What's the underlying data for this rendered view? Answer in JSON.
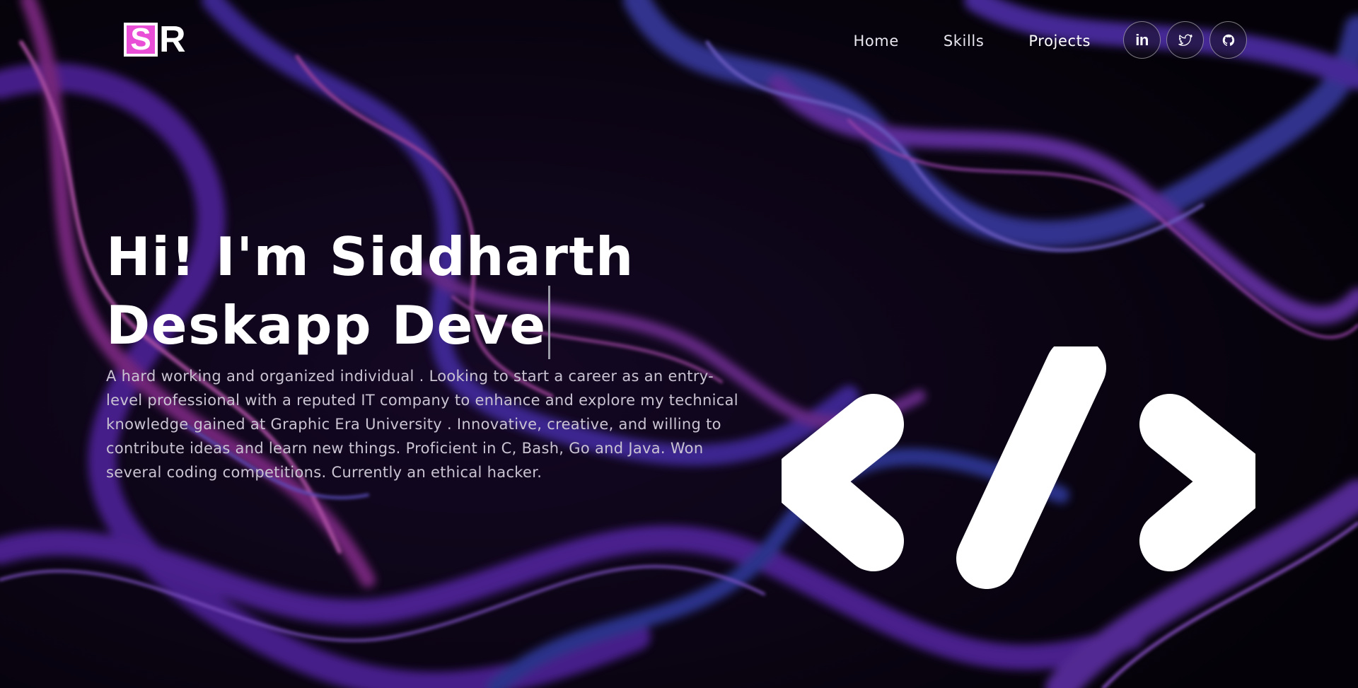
{
  "logo": {
    "letter_1": "S",
    "letter_2": "R"
  },
  "nav": {
    "items": [
      {
        "label": "Home"
      },
      {
        "label": "Skills"
      },
      {
        "label": "Projects"
      }
    ]
  },
  "socials": [
    {
      "name": "linkedin-icon",
      "glyph": "in"
    },
    {
      "name": "twitter-icon"
    },
    {
      "name": "github-icon"
    }
  ],
  "hero": {
    "title_line_1": "Hi! I'm Siddharth",
    "title_line_2": "Deskapp Deve",
    "description": "A hard working and organized individual . Looking to start a career as an entry-level professional with a reputed IT company to enhance and explore my technical knowledge gained at Graphic Era University . Innovative, creative, and willing to contribute ideas and learn new things. Proficient in C, Bash, Go and Java. Won several coding competitions. Currently an ethical hacker."
  },
  "colors": {
    "accent_pink": "#e94fd6",
    "background": "#07040d",
    "swirl_purple": "#7b3fe4",
    "swirl_magenta": "#c13cc0",
    "swirl_blue": "#4a57d6"
  },
  "illustration": {
    "icon": "code-brackets-icon"
  }
}
